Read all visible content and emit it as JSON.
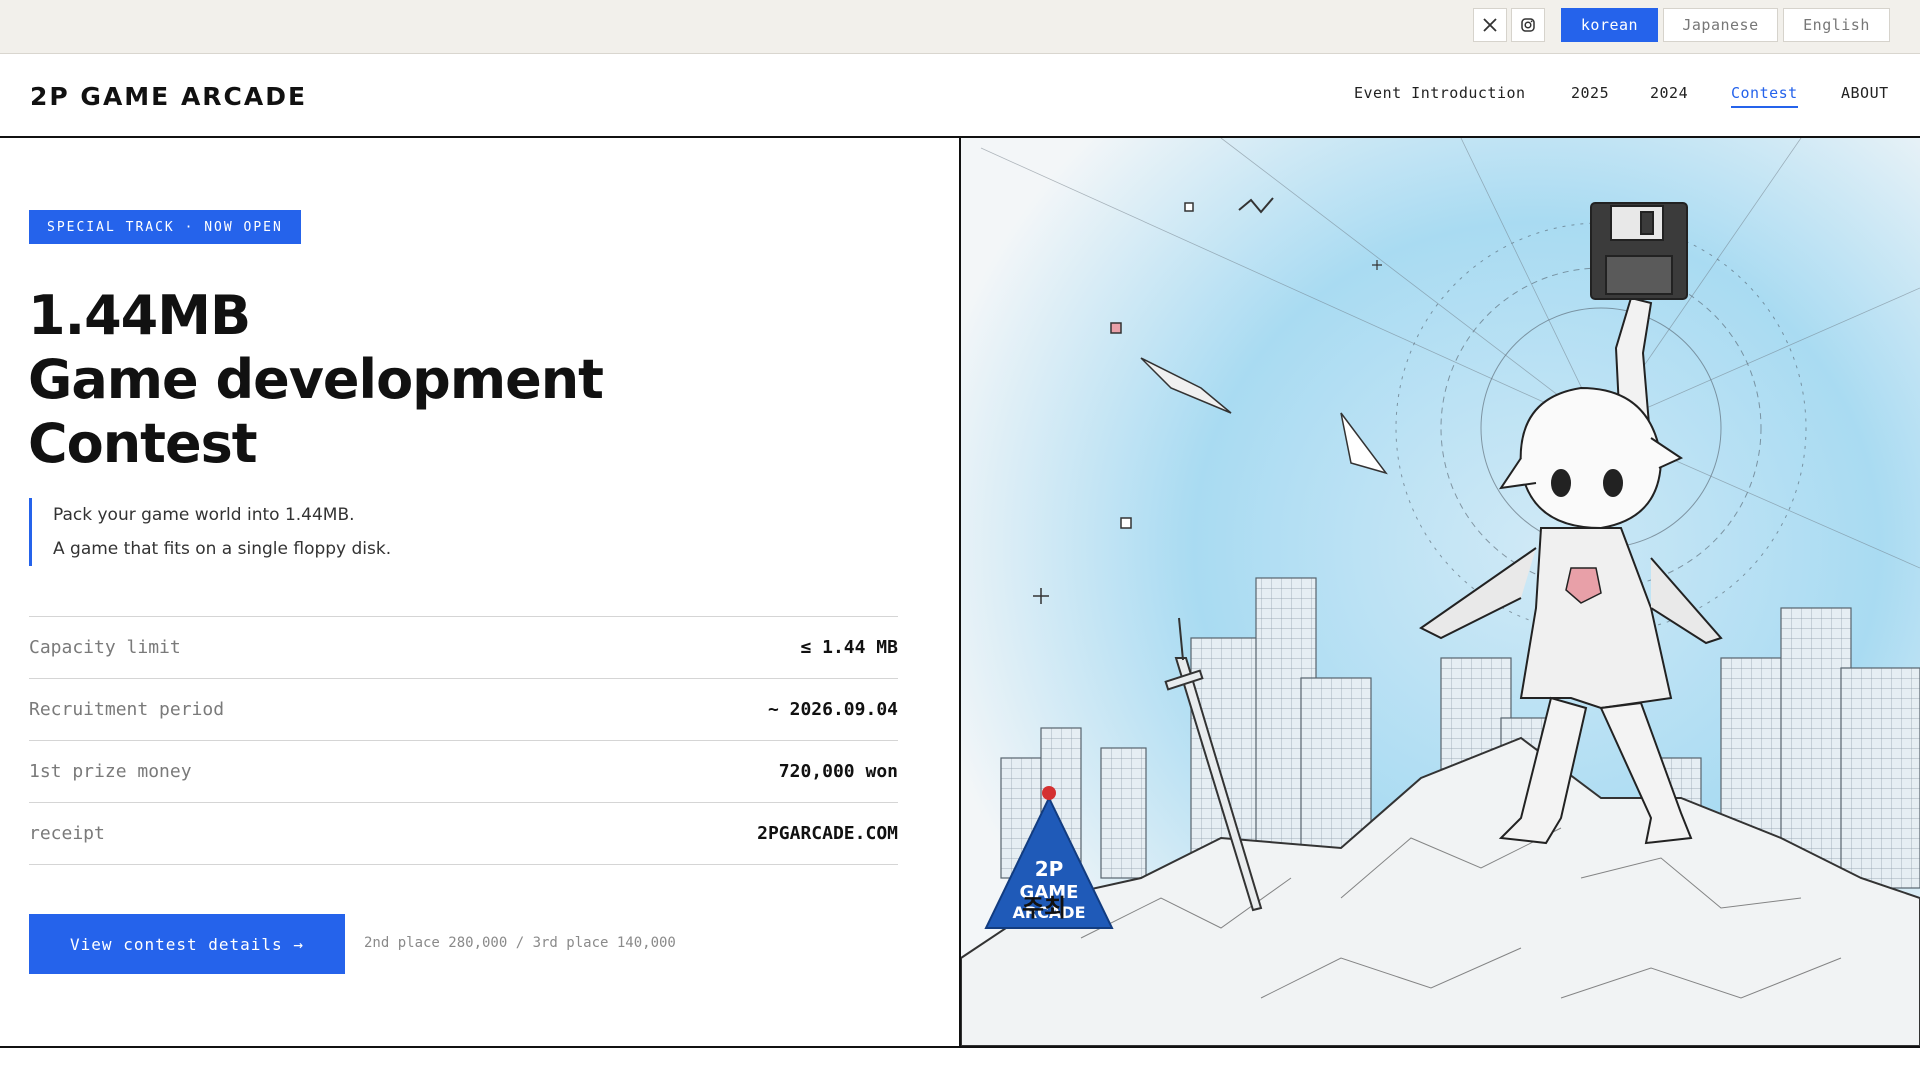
{
  "topbar": {
    "social": [
      {
        "name": "x-icon"
      },
      {
        "name": "instagram-icon"
      }
    ],
    "languages": [
      {
        "label": "korean",
        "active": true
      },
      {
        "label": "Japanese",
        "active": false
      },
      {
        "label": "English",
        "active": false
      }
    ]
  },
  "header": {
    "logo": "2P GAME ARCADE",
    "nav": [
      {
        "label": "Event Introduction",
        "active": false
      },
      {
        "label": "2025",
        "active": false
      },
      {
        "label": "2024",
        "active": false
      },
      {
        "label": "Contest",
        "active": true
      },
      {
        "label": "ABOUT",
        "active": false
      }
    ]
  },
  "hero": {
    "badge": "SPECIAL TRACK · NOW OPEN",
    "title_lines": [
      "1.44MB",
      "Game development",
      "Contest"
    ],
    "tagline_lines": [
      "Pack your game world into 1.44MB.",
      "A game that fits on a single floppy disk."
    ],
    "specs": [
      {
        "label": "Capacity limit",
        "value": "≤ 1.44 MB"
      },
      {
        "label": "Recruitment period",
        "value": "~ 2026.09.04"
      },
      {
        "label": "1st prize money",
        "value": "720,000 won"
      },
      {
        "label": "receipt",
        "value": "2PGARCADE.COM"
      }
    ],
    "cta_label": "View contest details →",
    "cta_note": "2nd place 280,000 / 3rd place 140,000"
  },
  "illustration": {
    "host_label": "주최",
    "host_logo_lines": [
      "2P",
      "GAME",
      "ARCADE"
    ]
  },
  "colors": {
    "accent": "#2563eb",
    "topbar_bg": "#f2f0eb",
    "text": "#111111"
  }
}
